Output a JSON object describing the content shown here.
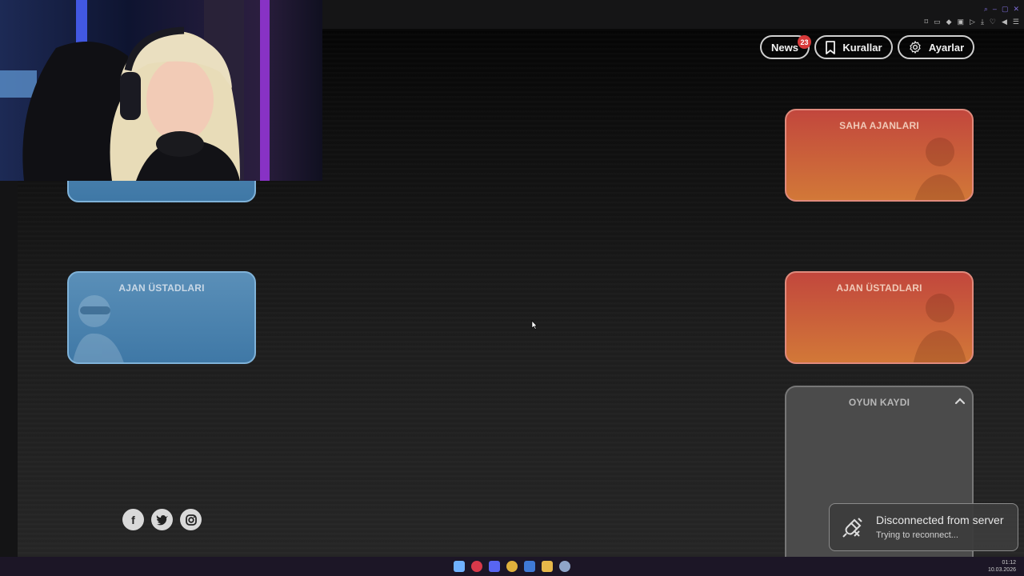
{
  "header": {
    "news_label": "News",
    "news_badge": "23",
    "rules_label": "Kurallar",
    "settings_label": "Ayarlar"
  },
  "left_team": {
    "cards": [
      {
        "label": ""
      },
      {
        "label": "AJAN ÜSTADLARI"
      }
    ]
  },
  "right_team": {
    "cards": [
      {
        "label": "SAHA AJANLARI"
      },
      {
        "label": "AJAN ÜSTADLARI"
      }
    ]
  },
  "game_log": {
    "label": "OYUN KAYDI"
  },
  "toast": {
    "title": "Disconnected from server",
    "subtitle": "Trying to reconnect..."
  },
  "taskbar": {
    "time": "01:12",
    "date": "10.03.2026"
  },
  "colors": {
    "blue_team": "#4a83b1",
    "red_team": "#c95a3b",
    "badge": "#d83a3a"
  }
}
